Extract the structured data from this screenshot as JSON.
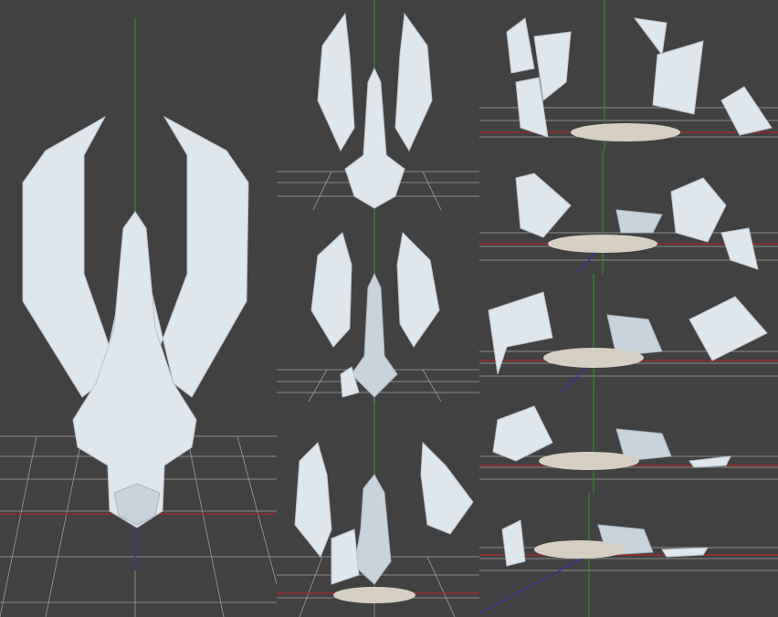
{
  "sheet": {
    "background": "#404040",
    "shard_color": "#dfe6ec",
    "rubble_color": "#d6d0c4",
    "axis_colors": {
      "x": "#9c2a2a",
      "y": "#2f8a2f",
      "z": "#3232a8"
    },
    "frames": [
      {
        "id": "intact",
        "state": "whole dragon silhouette"
      },
      {
        "id": "crack-1",
        "state": "cracked"
      },
      {
        "id": "crack-2",
        "state": "splitting"
      },
      {
        "id": "crack-3",
        "state": "falling apart"
      },
      {
        "id": "fall-1",
        "state": "shards falling"
      },
      {
        "id": "fall-2",
        "state": "shards falling"
      },
      {
        "id": "fall-3",
        "state": "shards landing"
      },
      {
        "id": "fall-4",
        "state": "rubble pile"
      },
      {
        "id": "fall-5",
        "state": "rubble pile"
      }
    ]
  }
}
